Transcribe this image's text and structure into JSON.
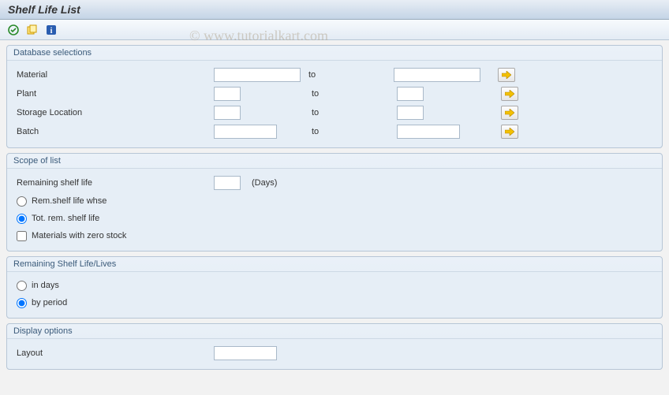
{
  "title": "Shelf Life List",
  "watermark": "© www.tutorialkart.com",
  "toolbar": {
    "execute_icon": "execute-icon",
    "variant_icon": "variant-icon",
    "info_icon": "info-icon"
  },
  "groups": {
    "db": {
      "title": "Database selections",
      "rows": {
        "material": {
          "label": "Material",
          "from": "",
          "to_label": "to",
          "to": ""
        },
        "plant": {
          "label": "Plant",
          "from": "",
          "to_label": "to",
          "to": ""
        },
        "storloc": {
          "label": "Storage Location",
          "from": "",
          "to_label": "to",
          "to": ""
        },
        "batch": {
          "label": "Batch",
          "from": "",
          "to_label": "to",
          "to": ""
        }
      }
    },
    "scope": {
      "title": "Scope of list",
      "remaining": {
        "label": "Remaining shelf life",
        "value": "",
        "unit": "(Days)"
      },
      "opt_whse": "Rem.shelf life whse",
      "opt_tot": "Tot. rem. shelf life",
      "chk_zero": "Materials with zero stock",
      "selected_radio": "tot",
      "zero_checked": false
    },
    "rsl": {
      "title": "Remaining Shelf Life/Lives",
      "opt_days": "in days",
      "opt_period": "by period",
      "selected": "period"
    },
    "display": {
      "title": "Display options",
      "layout_label": "Layout",
      "layout_value": ""
    }
  }
}
